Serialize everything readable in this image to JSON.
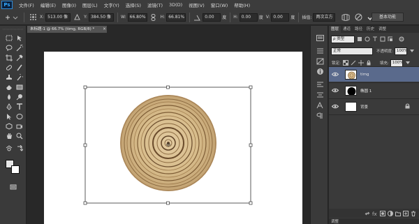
{
  "app": {
    "logo_text": "Ps"
  },
  "menu": [
    "文件(F)",
    "编辑(E)",
    "图像(I)",
    "图层(L)",
    "文字(Y)",
    "选择(S)",
    "滤镜(T)",
    "3D(D)",
    "视图(V)",
    "窗口(W)",
    "帮助(H)"
  ],
  "options_bar": {
    "x_label": "X:",
    "x_value": "513.00 像",
    "y_label": "Y:",
    "y_value": "384.50 像",
    "w_label": "W:",
    "w_value": "66.80%",
    "h_label": "H:",
    "h_value": "66.81%",
    "angle_value": "0.00",
    "angle_unit": "度",
    "hskew_label": "H:",
    "hskew_value": "0.00",
    "hskew_unit": "度",
    "vskew_label": "V:",
    "vskew_value": "0.00",
    "vskew_unit": "度",
    "interp_label": "插值:",
    "interp_value": "两次立方",
    "workspace": "基本功能"
  },
  "document": {
    "tab_title": "未标题-1 @ 66.7% (timg, RGB/8) *",
    "close_glyph": "×"
  },
  "layers_panel": {
    "tabs": [
      "图层",
      "通道",
      "路径",
      "历史",
      "调整"
    ],
    "kind_label": "ρ 类型",
    "blend_mode": "正常",
    "opacity_label": "不透明度:",
    "opacity_value": "100%",
    "lock_label": "锁定:",
    "fill_label": "填充:",
    "fill_value": "100%",
    "layers": [
      {
        "name": "timg",
        "selected": true
      },
      {
        "name": "椭圆 1",
        "selected": false
      },
      {
        "name": "背景",
        "selected": false
      }
    ],
    "footer_label": "调整"
  },
  "colors": {
    "foreground": "#e6e6e6",
    "background": "#ffffff",
    "selection": "#5a6a8c"
  }
}
